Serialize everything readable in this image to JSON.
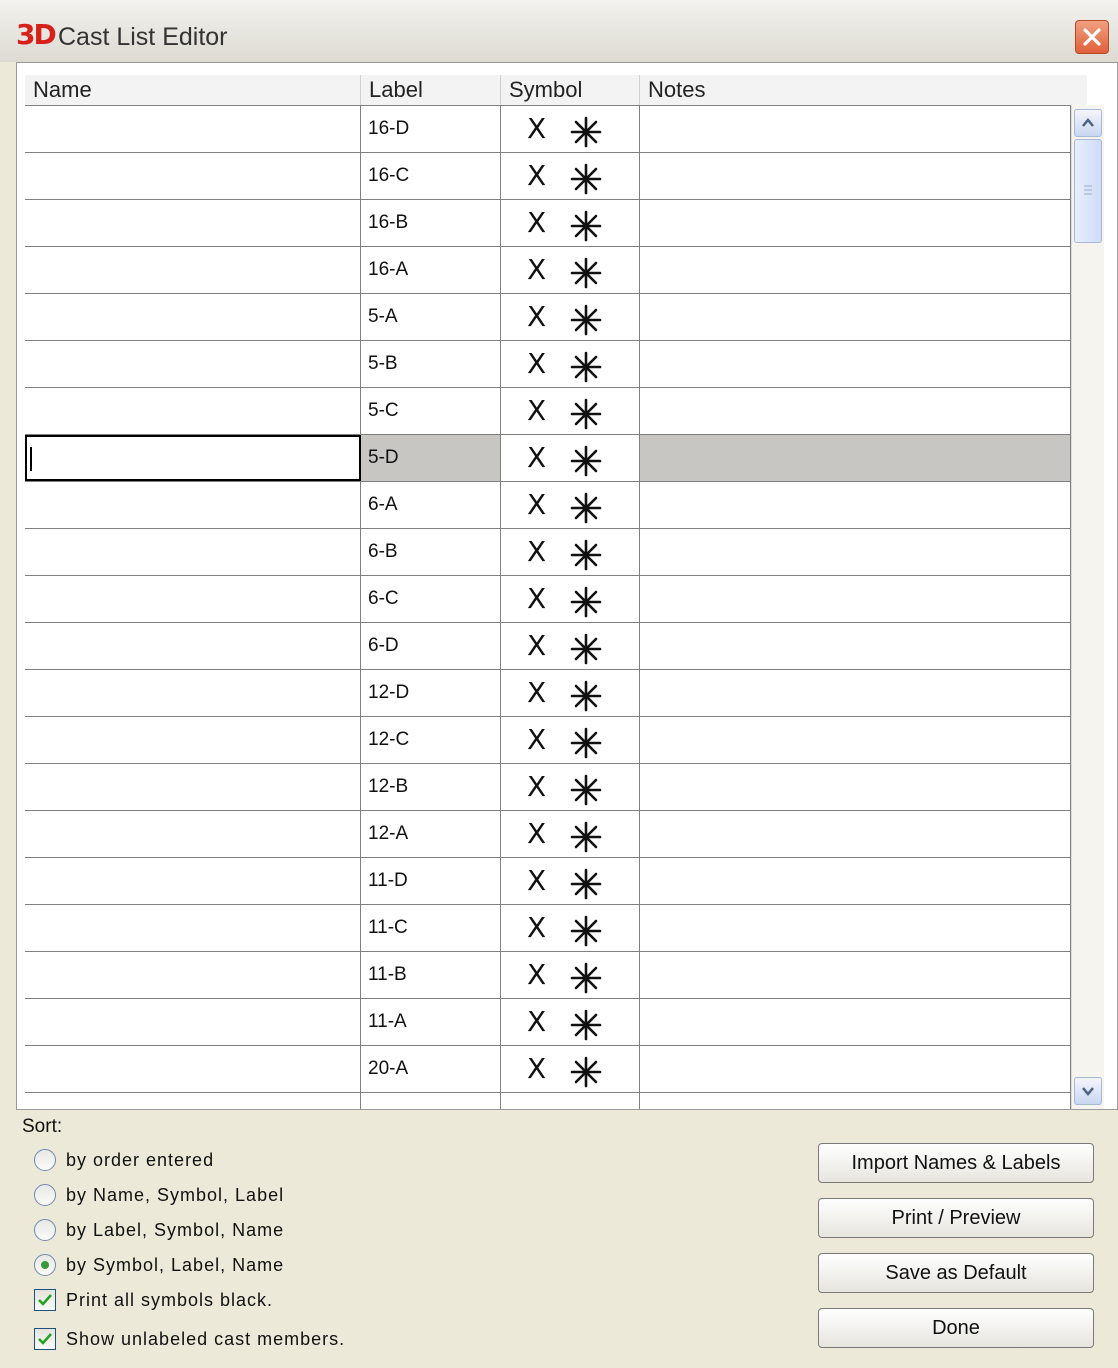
{
  "window": {
    "logo_text": "3D",
    "title": "Cast List Editor"
  },
  "table": {
    "columns": [
      "Name",
      "Label",
      "Symbol",
      "Notes"
    ],
    "rows": [
      {
        "name": "",
        "label": "16-D",
        "symbol_x": "X",
        "symbol_star": "asterisk-icon",
        "notes": ""
      },
      {
        "name": "",
        "label": "16-C",
        "symbol_x": "X",
        "symbol_star": "asterisk-icon",
        "notes": ""
      },
      {
        "name": "",
        "label": "16-B",
        "symbol_x": "X",
        "symbol_star": "asterisk-icon",
        "notes": ""
      },
      {
        "name": "",
        "label": "16-A",
        "symbol_x": "X",
        "symbol_star": "asterisk-icon",
        "notes": ""
      },
      {
        "name": "",
        "label": "5-A",
        "symbol_x": "X",
        "symbol_star": "asterisk-icon",
        "notes": ""
      },
      {
        "name": "",
        "label": "5-B",
        "symbol_x": "X",
        "symbol_star": "asterisk-icon",
        "notes": ""
      },
      {
        "name": "",
        "label": "5-C",
        "symbol_x": "X",
        "symbol_star": "asterisk-icon",
        "notes": ""
      },
      {
        "name": "",
        "label": "5-D",
        "symbol_x": "X",
        "symbol_star": "asterisk-icon",
        "notes": "",
        "selected": true
      },
      {
        "name": "",
        "label": "6-A",
        "symbol_x": "X",
        "symbol_star": "asterisk-icon",
        "notes": ""
      },
      {
        "name": "",
        "label": "6-B",
        "symbol_x": "X",
        "symbol_star": "asterisk-icon",
        "notes": ""
      },
      {
        "name": "",
        "label": "6-C",
        "symbol_x": "X",
        "symbol_star": "asterisk-icon",
        "notes": ""
      },
      {
        "name": "",
        "label": "6-D",
        "symbol_x": "X",
        "symbol_star": "asterisk-icon",
        "notes": ""
      },
      {
        "name": "",
        "label": "12-D",
        "symbol_x": "X",
        "symbol_star": "asterisk-icon",
        "notes": ""
      },
      {
        "name": "",
        "label": "12-C",
        "symbol_x": "X",
        "symbol_star": "asterisk-icon",
        "notes": ""
      },
      {
        "name": "",
        "label": "12-B",
        "symbol_x": "X",
        "symbol_star": "asterisk-icon",
        "notes": ""
      },
      {
        "name": "",
        "label": "12-A",
        "symbol_x": "X",
        "symbol_star": "asterisk-icon",
        "notes": ""
      },
      {
        "name": "",
        "label": "11-D",
        "symbol_x": "X",
        "symbol_star": "asterisk-icon",
        "notes": ""
      },
      {
        "name": "",
        "label": "11-C",
        "symbol_x": "X",
        "symbol_star": "asterisk-icon",
        "notes": ""
      },
      {
        "name": "",
        "label": "11-B",
        "symbol_x": "X",
        "symbol_star": "asterisk-icon",
        "notes": ""
      },
      {
        "name": "",
        "label": "11-A",
        "symbol_x": "X",
        "symbol_star": "asterisk-icon",
        "notes": ""
      },
      {
        "name": "",
        "label": "20-A",
        "symbol_x": "X",
        "symbol_star": "asterisk-icon",
        "notes": ""
      }
    ]
  },
  "sort": {
    "title": "Sort:",
    "options": [
      {
        "label": "by order entered",
        "checked": false
      },
      {
        "label": "by Name, Symbol, Label",
        "checked": false
      },
      {
        "label": "by Label, Symbol, Name",
        "checked": false
      },
      {
        "label": "by Symbol, Label, Name",
        "checked": true
      }
    ],
    "checkboxes": [
      {
        "label": "Print all symbols black.",
        "checked": true
      },
      {
        "label": "Show unlabeled cast members.",
        "checked": true
      }
    ]
  },
  "buttons": {
    "import": "Import Names & Labels",
    "print": "Print / Preview",
    "save_default": "Save as Default",
    "done": "Done"
  },
  "colors": {
    "window_bg": "#ece9d8",
    "selection_bg": "#c8c6c2",
    "logo": "#d8201a",
    "close_button": "#e0603a",
    "radio_dot": "#3a9a3a"
  }
}
